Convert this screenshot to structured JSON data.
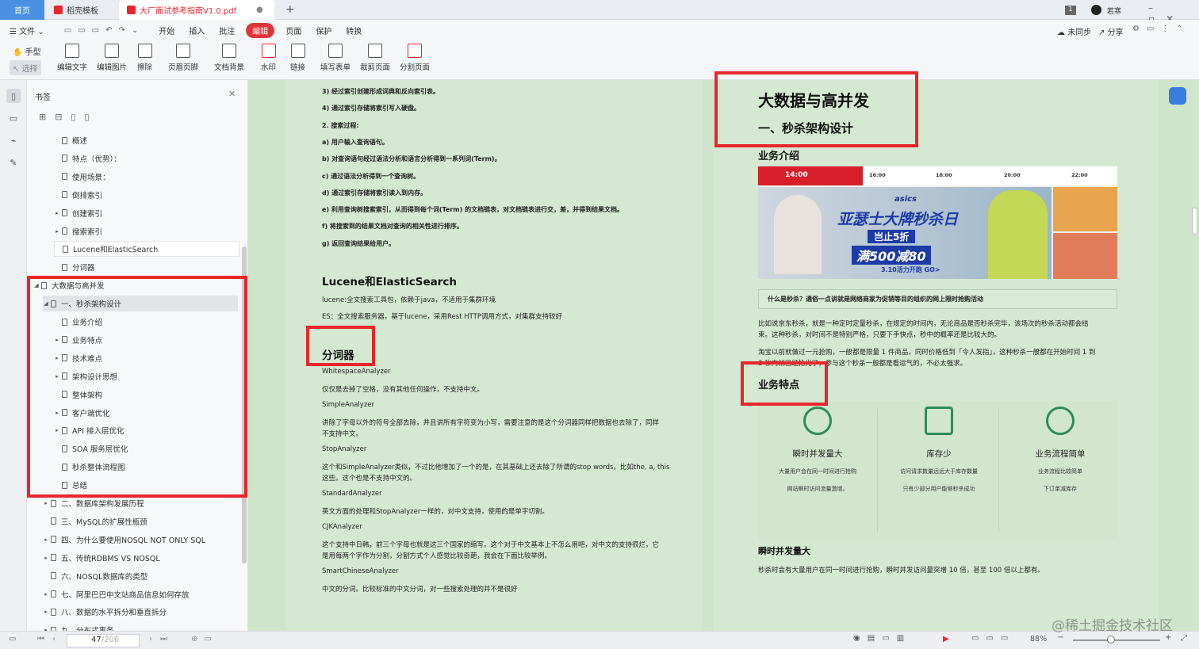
{
  "tabs": {
    "home": "首页",
    "templates": "稻壳模板",
    "pdf": "大厂面试参考指南V1.0.pdf",
    "user": "若寒",
    "badge": "1"
  },
  "menu": {
    "file": "文件",
    "items": [
      "开始",
      "插入",
      "批注",
      "编辑",
      "页面",
      "保护",
      "转换"
    ],
    "sync": "未同步",
    "share": "分享"
  },
  "toolbar": {
    "hand": "手型",
    "select": "选择",
    "tools": [
      "编辑文字",
      "编辑图片",
      "擦除",
      "页眉页脚",
      "文档背景",
      "水印",
      "链接",
      "填写表单",
      "裁剪页面",
      "分割页面"
    ]
  },
  "panel": {
    "title": "书签",
    "items": [
      {
        "label": "概述"
      },
      {
        "label": "特点（优势）："
      },
      {
        "label": "使用场景："
      },
      {
        "label": "倒排索引"
      },
      {
        "label": "创建索引",
        "arrow": "▸"
      },
      {
        "label": "搜索索引",
        "arrow": "▸"
      },
      {
        "label": "Lucene和ElasticSearch"
      },
      {
        "label": "分词器"
      },
      {
        "label": "大数据与高并发",
        "arrow": "◢"
      },
      {
        "label": "一、秒杀架构设计",
        "arrow": "◢"
      },
      {
        "label": "业务介绍"
      },
      {
        "label": "业务特点",
        "arrow": "▸"
      },
      {
        "label": "技术难点",
        "arrow": "▸"
      },
      {
        "label": "架构设计思想",
        "arrow": "▸"
      },
      {
        "label": "整体架构"
      },
      {
        "label": "客户端优化",
        "arrow": "▸"
      },
      {
        "label": "API 接入层优化",
        "arrow": "▸"
      },
      {
        "label": "SOA 服务层优化"
      },
      {
        "label": "秒杀整体流程图"
      },
      {
        "label": "总结"
      },
      {
        "label": "二、数据库架构发展历程",
        "arrow": "▸"
      },
      {
        "label": "三、MySQL的扩展性瓶颈"
      },
      {
        "label": "四、为什么要使用NOSQL    NOT ONLY SQL",
        "arrow": "▸"
      },
      {
        "label": "五、传统RDBMS VS NOSQL",
        "arrow": "▸"
      },
      {
        "label": "六、NOSQL数据库的类型"
      },
      {
        "label": "七、阿里巴巴中文站商品信息如何存放",
        "arrow": "▸"
      },
      {
        "label": "八、数据的水平拆分和垂直拆分",
        "arrow": "▸"
      },
      {
        "label": "九、分布式事务",
        "arrow": "▸"
      }
    ]
  },
  "left_page": {
    "steps": [
      "3) 经过索引创建形成词典和反向索引表。",
      "4) 通过索引存储将索引写入硬盘。",
      "2. 搜索过程:",
      "a) 用户输入查询语句。",
      "b) 对查询语句经过语法分析和语言分析得到一系列词(Term)。",
      "c) 通过语法分析得到一个查询树。",
      "d) 通过索引存储将索引读入到内存。",
      "e) 利用查询树搜索索引，从而得到每个词(Term) 的文档链表，对文档链表进行交，差，并得到结果文档。",
      "f) 将搜索到的结果文档对查询的相关性进行排序。",
      "g) 返回查询结果给用户。"
    ],
    "lucene_title": "Lucene和ElasticSearch",
    "lucene_1": "lucene:全文搜索工具包，依赖于java，不适用于集群环境",
    "lucene_2": "ES：全文搜索服务器，基于lucene，采用Rest HTTP调用方式，对集群支持较好",
    "tokenizer_title": "分词器",
    "tok": [
      "WhitespaceAnalyzer",
      "仅仅是去掉了空格，没有其他任何操作，不支持中文。",
      "SimpleAnalyzer",
      "讲除了字母以外的符号全部去除，并且讲所有字符变为小写，需要注意的是这个分词器同样把数据也去除了，同样",
      "不支持中文。",
      "StopAnalyzer",
      "这个和SimpleAnalyzer类似，不过比他增加了一个的是，在其基础上还去除了所谓的stop words，比如the, a, this",
      "这些。这个也是不支持中文的。",
      "StandardAnalyzer",
      "英文方面的处理和StopAnalyzer一样的，对中文支持，使用的是单字切割。",
      "CJKAnalyzer",
      "这个支持中日韩，前三个字母也就是这三个国家的缩写。这个对于中文基本上不怎么用吧，对中文的支持很烂，它",
      "是用每两个字作为分割，分割方式个人感觉比较奇葩，我会在下面比较举例。",
      "SmartChineseAnalyzer",
      "中文的分词。比较标准的中文分词，对一些搜索处理的并不是很好"
    ]
  },
  "right_page": {
    "h1": "大数据与高并发",
    "h2": "一、秒杀架构设计",
    "biz_intro": "业务介绍",
    "banner": {
      "time": "14:00",
      "slots": [
        "16:00",
        "18:00",
        "20:00",
        "22:00"
      ],
      "brand": "asics",
      "title": "亚瑟士大牌秒杀日",
      "discount": "岂止5折",
      "promo": "满500减80",
      "date": "3.10活力开跑 GO>"
    },
    "caption": "什么是秒杀？通俗一点讲就是网络商家为促销等目的组织的网上限时抢购活动",
    "p1a": "比如说京东秒杀，就是一种定时定量秒杀，在规定的时间内，无论商品是否秒杀完毕，该场次的秒杀活动都会结",
    "p1b": "束。这种秒杀，对时间不是特别严格，只要下手快点，秒中的概率还是比较大的。",
    "p2a": "淘宝以前就做过一元抢购，一般都是限量 1 件商品，同时价格低到「令人发指」，这种秒杀一般都在开始时间 1 到",
    "p2b": "3 秒内就已经抢光了，参与这个秒杀一般都是看运气的，不必太强求。",
    "biz_feat": "业务特点",
    "features": [
      {
        "title": "瞬时并发量大",
        "b1": "大量用户会在同一时间进行抢购",
        "b2": "网站瞬时访问流量激增。"
      },
      {
        "title": "库存少",
        "b1": "访问请求数量远远大于库存数量",
        "b2": "只有少部分用户能够秒杀成功"
      },
      {
        "title": "业务流程简单",
        "b1": "业务流程比较简单",
        "b2": "下订单减库存"
      }
    ],
    "conc_title": "瞬时并发量大",
    "conc_text": "秒杀时会有大量用户在同一时间进行抢购，瞬时并发访问量突增 10 倍，甚至 100 倍以上都有。"
  },
  "status": {
    "page": "47",
    "total": "/206",
    "zoom": "88%",
    "watermark": "@稀土掘金技术社区"
  }
}
